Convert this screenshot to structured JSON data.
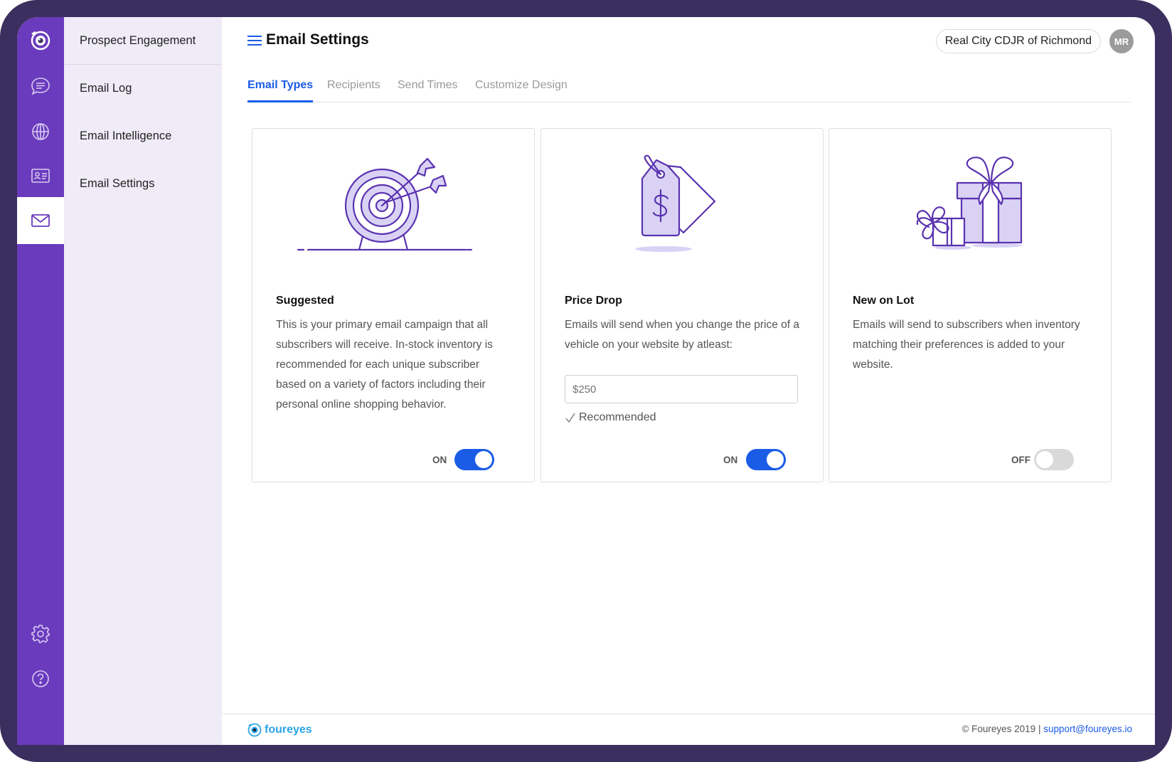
{
  "rail": {
    "items": [
      {
        "icon": "logo-eye-icon"
      },
      {
        "icon": "chat-bubble-icon"
      },
      {
        "icon": "globe-icon"
      },
      {
        "icon": "contact-card-icon"
      },
      {
        "icon": "envelope-icon",
        "active": true
      },
      {
        "icon": "gear-icon"
      },
      {
        "icon": "help-icon"
      }
    ]
  },
  "subnav": {
    "header": "Prospect Engagement",
    "items": [
      "Email Log",
      "Email Intelligence",
      "Email Settings"
    ]
  },
  "header": {
    "title": "Email Settings",
    "dealer": "Real City CDJR of Richmond",
    "avatar_initials": "MR"
  },
  "tabs": [
    "Email Types",
    "Recipients",
    "Send Times",
    "Customize Design"
  ],
  "cards": [
    {
      "illustration": "target-with-arrows-icon",
      "title": "Suggested",
      "description": "This is your primary email campaign that all subscribers will receive. In-stock inventory is recommended for each unique subscriber based on a variety of factors including their personal online shopping behavior.",
      "toggle_label": "ON",
      "enabled": true
    },
    {
      "illustration": "price-tag-icon",
      "title": "Price Drop",
      "description": "Emails will send when you change the price of a vehicle on your website by atleast:",
      "input_placeholder": "$250",
      "recommended": "Recommended",
      "toggle_label": "ON",
      "enabled": true
    },
    {
      "illustration": "gift-boxes-icon",
      "title": "New on Lot",
      "description": "Emails will send to subscribers when inventory matching their preferences is added to your website.",
      "toggle_label": "OFF",
      "enabled": false
    }
  ],
  "footer": {
    "logo_text": "foureyes",
    "copyright": "© Foureyes 2019 |",
    "support_email": "support@foureyes.io"
  },
  "colors": {
    "rail": "#6a3bbd",
    "accent": "#1a5ce6",
    "illustration_stroke": "#5a33b0",
    "illustration_fill": "#d9d2f5"
  }
}
